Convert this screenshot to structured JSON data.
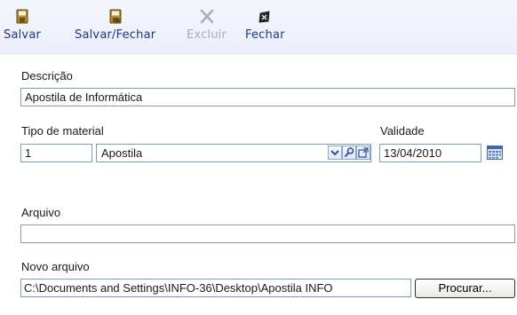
{
  "toolbar": {
    "buttons": [
      {
        "label": "Salvar",
        "icon": "save-icon",
        "disabled": false
      },
      {
        "label": "Salvar/Fechar",
        "icon": "save-close-icon",
        "disabled": false
      },
      {
        "label": "Excluir",
        "icon": "delete-icon",
        "disabled": true
      },
      {
        "label": "Fechar",
        "icon": "close-icon",
        "disabled": false
      }
    ]
  },
  "form": {
    "descricao": {
      "label": "Descrição",
      "value": "Apostila de Informática"
    },
    "tipo_material": {
      "label": "Tipo de material",
      "code": "1",
      "name": "Apostila",
      "icons": [
        "dropdown-icon",
        "search-icon",
        "open-window-icon"
      ]
    },
    "validade": {
      "label": "Validade",
      "value": "13/04/2010",
      "icon": "calendar-icon"
    },
    "arquivo": {
      "label": "Arquivo",
      "value": ""
    },
    "novo_arquivo": {
      "label": "Novo arquivo",
      "value": "C:\\Documents and Settings\\INFO-36\\Desktop\\Apostila INFO",
      "browse_label": "Procurar..."
    }
  },
  "colors": {
    "toolbar_label": "#1b3a8c",
    "toolbar_label_disabled": "#a7adbd",
    "field_border": "#7f9db9",
    "toolbar_bg": "#eef1fb"
  }
}
